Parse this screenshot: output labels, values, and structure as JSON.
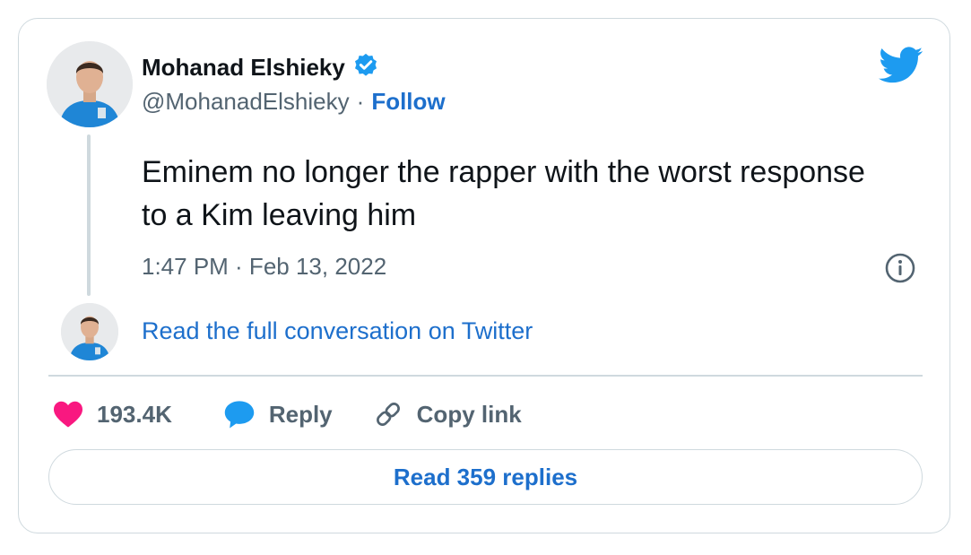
{
  "author": {
    "name": "Mohanad Elshieky",
    "handle": "@MohanadElshieky",
    "separator": "·",
    "follow_label": "Follow",
    "verified": true
  },
  "tweet": {
    "text": "Eminem no longer the rapper with the worst response to a Kim leaving him",
    "timestamp": "1:47 PM · Feb 13, 2022"
  },
  "conversation": {
    "read_full_label": "Read the full conversation on Twitter"
  },
  "actions": {
    "likes_count": "193.4K",
    "reply_label": "Reply",
    "copy_link_label": "Copy link"
  },
  "replies": {
    "button_label": "Read 359 replies"
  },
  "colors": {
    "accent": "#1d6fcc",
    "twitter_blue": "#1d9bf0",
    "like": "#f91880",
    "text": "#0f1419",
    "muted": "#536471",
    "border": "#cfd9de"
  },
  "icons": {
    "verified": "verified-badge-icon",
    "logo": "twitter-bird-icon",
    "info": "info-icon",
    "like": "heart-icon",
    "reply": "speech-bubble-icon",
    "copy_link": "link-icon"
  }
}
